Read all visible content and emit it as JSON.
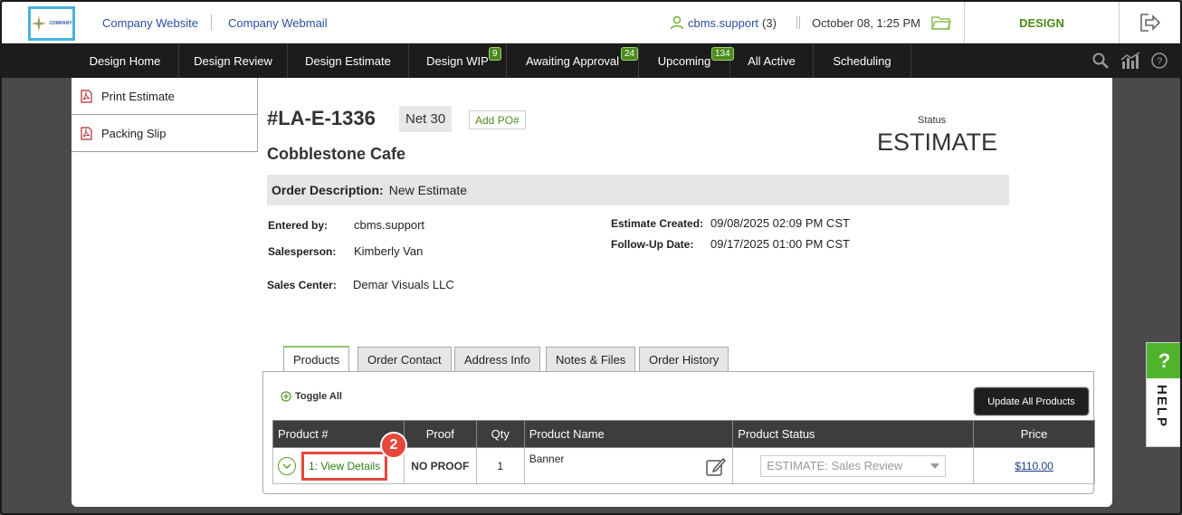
{
  "header": {
    "logo_text": "COMPANY",
    "links": [
      "Company Website",
      "Company Webmail"
    ],
    "user": "cbms.support",
    "user_count": "(3)",
    "datetime": "October 08, 1:25 PM",
    "mode": "DESIGN"
  },
  "nav": {
    "items": [
      {
        "label": "Design Home"
      },
      {
        "label": "Design Review"
      },
      {
        "label": "Design Estimate"
      },
      {
        "label": "Design WIP",
        "badge": "9"
      },
      {
        "label": "Awaiting Approval",
        "badge": "24"
      },
      {
        "label": "Upcoming",
        "badge": "134"
      },
      {
        "label": "All Active"
      },
      {
        "label": "Scheduling"
      }
    ]
  },
  "sidebar": {
    "items": [
      {
        "label": "Print Estimate"
      },
      {
        "label": "Packing Slip"
      }
    ]
  },
  "order": {
    "number": "#LA-E-1336",
    "terms": "Net 30",
    "add_po": "Add PO#",
    "status_label": "Status",
    "status": "ESTIMATE",
    "customer": "Cobblestone Cafe",
    "description_label": "Order Description:",
    "description": "New Estimate",
    "entered_by_label": "Entered by:",
    "entered_by": "cbms.support",
    "salesperson_label": "Salesperson:",
    "salesperson": "Kimberly Van",
    "sales_center_label": "Sales Center:",
    "sales_center": "Demar Visuals LLC",
    "created_label": "Estimate Created:",
    "created": "09/08/2025 02:09 PM CST",
    "followup_label": "Follow-Up Date:",
    "followup": "09/17/2025 01:00 PM CST"
  },
  "tabs": [
    "Products",
    "Order Contact",
    "Address Info",
    "Notes & Files",
    "Order History"
  ],
  "products": {
    "toggle_all": "Toggle All",
    "update_all": "Update All Products",
    "columns": [
      "Product #",
      "Proof",
      "Qty",
      "Product Name",
      "Product Status",
      "Price"
    ],
    "rows": [
      {
        "product_num": "1: View Details",
        "proof": "NO PROOF",
        "qty": "1",
        "name": "Banner",
        "status": "ESTIMATE: Sales Review",
        "price": "$110.00"
      }
    ],
    "callout": "2"
  },
  "help": {
    "q": "?",
    "label": "HELP"
  },
  "colors": {
    "accent_green": "#4c8a1c",
    "nav_bg": "#1c1c1c",
    "callout_red": "#e8473b"
  }
}
